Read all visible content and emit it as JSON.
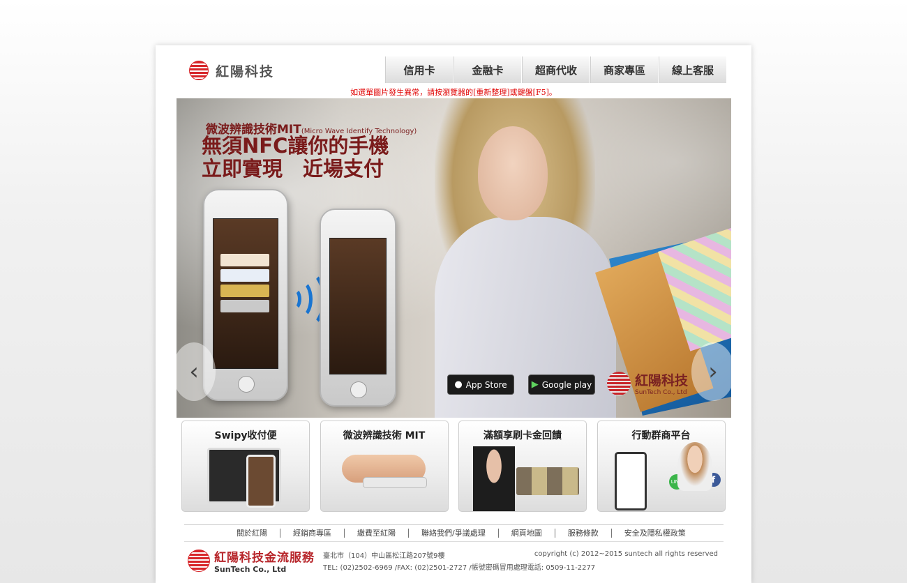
{
  "brand": {
    "name": "紅陽科技"
  },
  "nav": {
    "items": [
      {
        "label": "信用卡"
      },
      {
        "label": "金融卡"
      },
      {
        "label": "超商代收"
      },
      {
        "label": "商家專區"
      },
      {
        "label": "線上客服"
      }
    ]
  },
  "notice": "如選單圖片發生異常，請按瀏覽器的[重新整理]或鍵盤[F5]。",
  "banner": {
    "subheadline": "微波辨識技術MIT",
    "subheadline_en": "(Micro Wave Identify Technology)",
    "headline_line1": "無須NFC讓你的手機",
    "headline_line2": "立即實現　近場支付",
    "appstore_label": "App Store",
    "googleplay_label": "Google play",
    "logo_name": "紅陽科技",
    "logo_en": "SunTech Co., Ltd",
    "prev_icon": "chevron-left-icon",
    "next_icon": "chevron-right-icon"
  },
  "tiles": [
    {
      "title": "Swipy收付便"
    },
    {
      "title": "微波辨識技術 MIT"
    },
    {
      "title": "滿額享刷卡金回饋"
    },
    {
      "title": "行動群商平台"
    }
  ],
  "footer": {
    "links": [
      {
        "label": "關於紅陽"
      },
      {
        "label": "經銷商專區"
      },
      {
        "label": "繳費至紅陽"
      },
      {
        "label": "聯絡我們/爭議處理"
      },
      {
        "label": "網頁地圖"
      },
      {
        "label": "服務條款"
      },
      {
        "label": "安全及隱私權政策"
      }
    ],
    "logo_name": "紅陽科技金流服務",
    "logo_en": "SunTech Co., Ltd",
    "address": "臺北市（104）中山區松江路207號9樓",
    "contact": "TEL: (02)2502-6969 /FAX: (02)2501-2727 /帳號密碼冒用處理電話: 0509-11-2277",
    "copyright": "copyright (c) 2012~2015 suntech all rights reserved"
  },
  "colors": {
    "brand_red": "#d7262a",
    "notice_red": "#e00000",
    "headline": "#7a1b1b"
  }
}
